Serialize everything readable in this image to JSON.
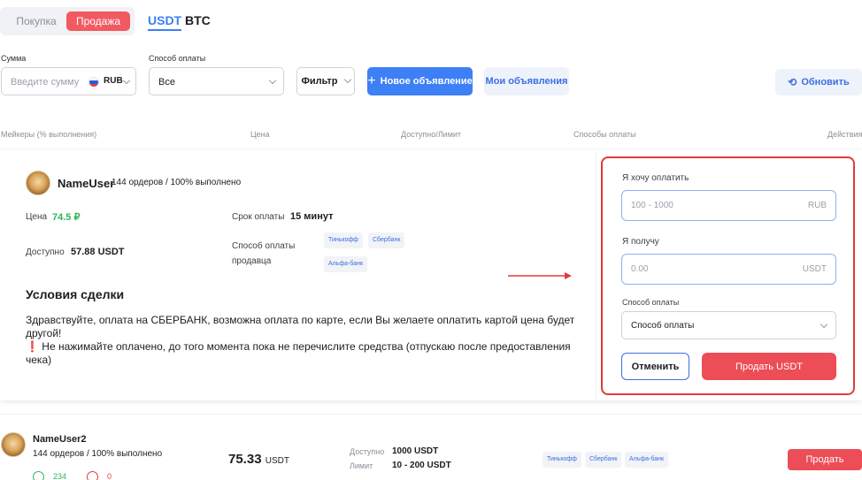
{
  "tabs": {
    "buy": "Покупка",
    "sell": "Продажа"
  },
  "coins": [
    "USDT",
    "BTC"
  ],
  "filters": {
    "amount_label": "Сумма",
    "amount_placeholder": "Введите сумму",
    "currency": "RUB",
    "payment_label": "Способ оплаты",
    "payment_value": "Все",
    "filter_button": "Фильтр",
    "new_ad_button": "Новое объявление",
    "my_ads_button": "Мои объявления",
    "refresh_button": "Обновить"
  },
  "table_header": {
    "makers": "Мейкеры (% выполнения)",
    "price": "Цена",
    "available": "Доступно/Лимит",
    "methods": "Способы оплаты",
    "actions": "Действия"
  },
  "expanded": {
    "user": "NameUser",
    "stats": "144 ордеров / 100% выполнено",
    "price_label": "Цена",
    "price": "74.5 ₽",
    "term_label": "Срок оплаты",
    "term": "15 минут",
    "available_label": "Доступно",
    "available": "57.88 USDT",
    "seller_methods_label": "Способ оплаты продавца",
    "methods": [
      "Тинькофф",
      "Сбербанк",
      "Альфа-банк"
    ],
    "conditions_title": "Условия сделки",
    "conditions_line1": "Здравствуйте, оплата на СБЕРБАНК, возможна оплата по карте, если Вы желаете оплатить картой цена будет другой!",
    "conditions_excl": "❗",
    "conditions_line2": " Не нажимайте оплачено, до того момента пока не перечислите средства (отпускаю после предоставления чека)"
  },
  "form": {
    "pay_label": "Я хочу оплатить",
    "pay_placeholder": "100 - 1000",
    "pay_currency": "RUB",
    "receive_label": "Я получу",
    "receive_placeholder": "0.00",
    "receive_currency": "USDT",
    "method_label": "Способ оплаты",
    "method_placeholder": "Способ оплаты",
    "cancel": "Отменить",
    "submit": "Продать USDT"
  },
  "row2": {
    "user": "NameUser2",
    "stats": "144 ордеров / 100% выполнено",
    "price": "75.33",
    "price_unit": "USDT",
    "available_label": "Доступно",
    "available": "1000 USDT",
    "limit_label": "Лимит",
    "limit": "10 - 200 USDT",
    "methods": [
      "Тинькофф",
      "Сбербанк",
      "Альфа-банк"
    ],
    "likes": "234",
    "dislikes": "0",
    "action": "Продать"
  },
  "colors": {
    "accent_blue": "#3d7ff5",
    "sell_red": "#ec4d56",
    "price_green": "#30b35d",
    "highlight_border": "#e33a3a"
  }
}
